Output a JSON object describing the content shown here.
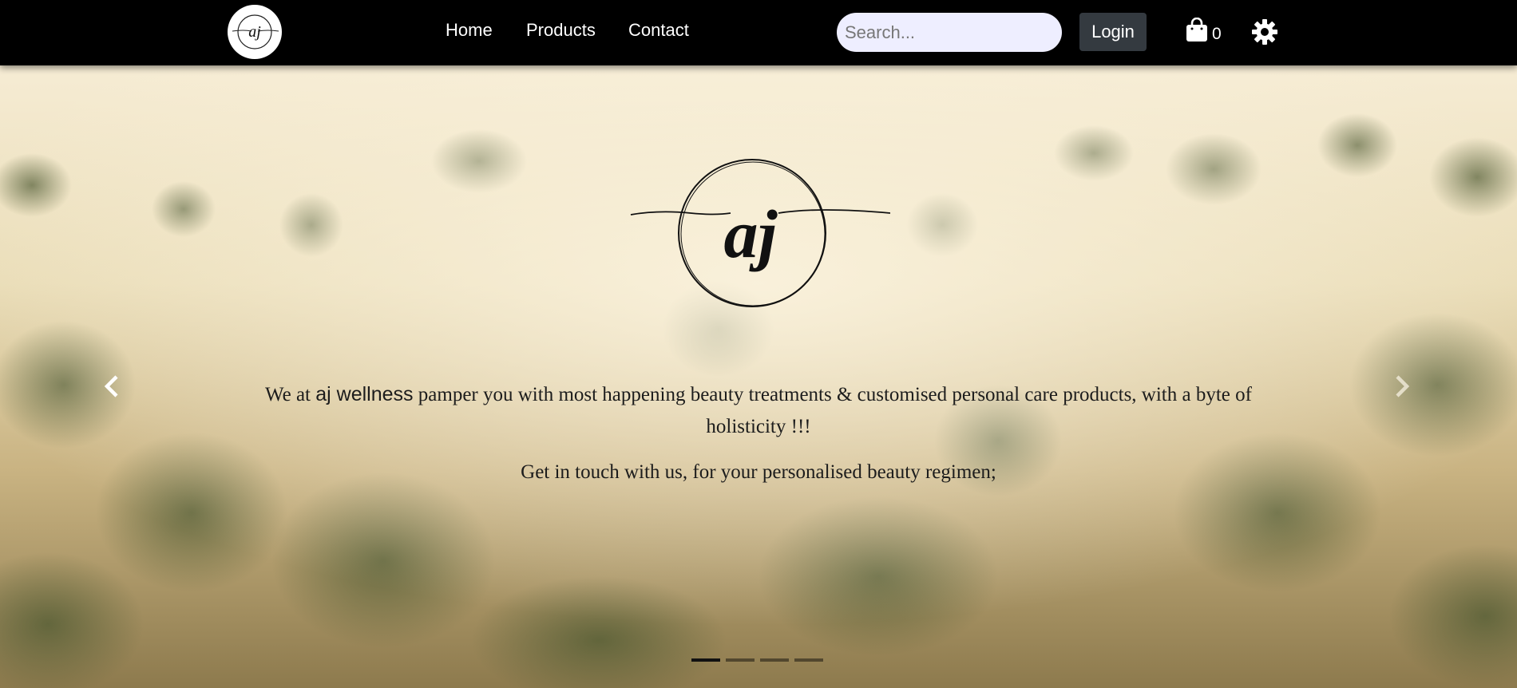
{
  "navbar": {
    "logo_text": "aj",
    "links": [
      {
        "label": "Home"
      },
      {
        "label": "Products"
      },
      {
        "label": "Contact"
      }
    ],
    "search": {
      "placeholder": "Search...",
      "value": ""
    },
    "login_label": "Login",
    "cart": {
      "icon": "shopping-bag-icon",
      "count": "0"
    },
    "settings_icon": "gear-icon"
  },
  "hero": {
    "logo_text": "aj",
    "intro_before": "We at ",
    "intro_brand": "aj wellness",
    "intro_after": " pamper you with most happening beauty treatments & customised personal care products, with a byte of holisticity !!!",
    "subtext": "Get in touch with us, for your personalised beauty regimen;",
    "prev_icon": "chevron-left-icon",
    "next_icon": "chevron-right-icon",
    "slides_count": 4,
    "active_slide": 1
  },
  "colors": {
    "navbar_bg": "#000000",
    "search_bg": "#eeeeff",
    "login_bg": "#343a40",
    "text_dark": "#1c1c1c"
  }
}
